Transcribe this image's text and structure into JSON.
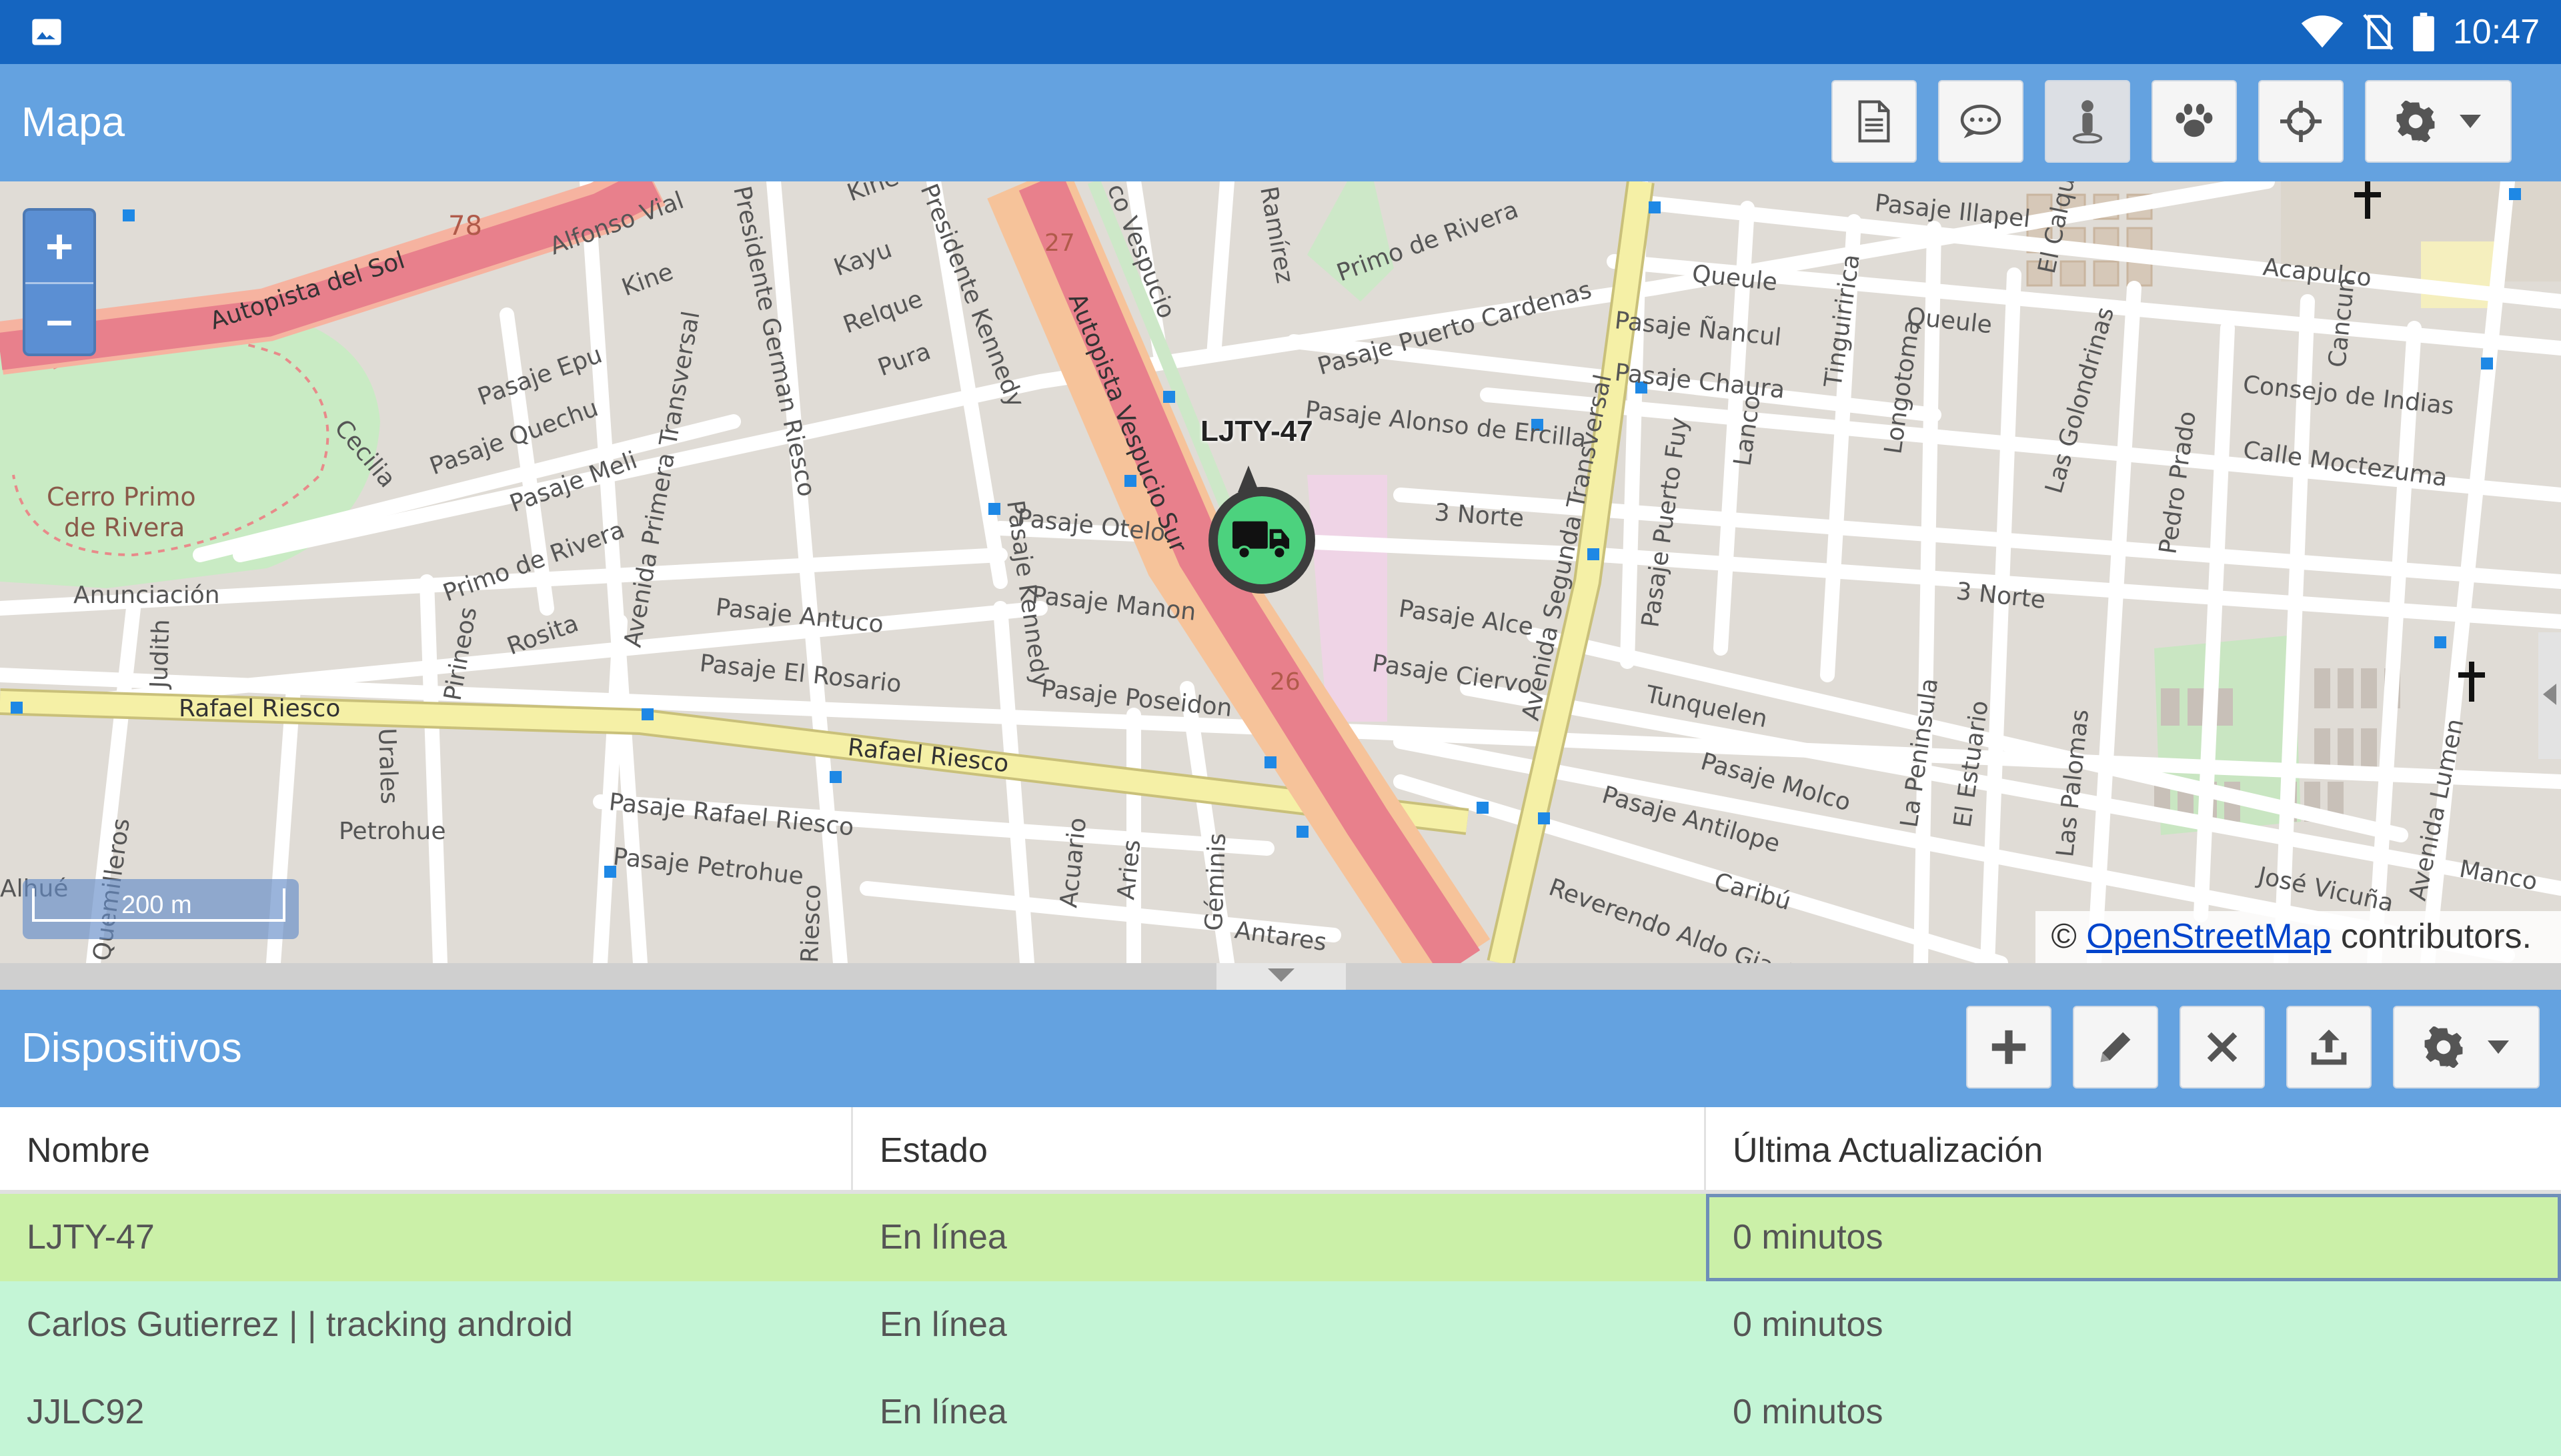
{
  "status_bar": {
    "time": "10:47",
    "icons": [
      "image-icon",
      "wifi-icon",
      "no-sim-icon",
      "battery-icon"
    ]
  },
  "map_panel": {
    "title": "Mapa",
    "toolbar": [
      "report-icon",
      "chat-icon",
      "person-pin-icon",
      "paw-icon",
      "crosshair-icon",
      "settings-dropdown-icon"
    ]
  },
  "map": {
    "zoom_in": "+",
    "zoom_out": "–",
    "scale": "200 m",
    "attribution_prefix": "©",
    "attribution_link": "OpenStreetMap",
    "attribution_suffix": "contributors.",
    "marker_label": "LJTY-47",
    "labels": {
      "autopista_sol": "Autopista del Sol",
      "route_78": "78",
      "alfonso_vial": "Alfonso Vial",
      "kine": "Kine",
      "kine2": "Kine",
      "kayu": "Kayu",
      "relque": "Relque",
      "pura": "Pura",
      "german_riesco": "Presidente German Riesco",
      "pres_kennedy": "Presidente Kennedy",
      "vespucio": "co Vespucio",
      "route_27": "27",
      "route_26": "26",
      "autopista_vespucio_sur": "Autopista Vespucio Sur",
      "pasaje_epu": "Pasaje Epu",
      "pasaje_quechu": "Pasaje Quechu",
      "pasaje_meli": "Pasaje Meli",
      "cecilia": "Cecilia",
      "cerro_primo": "Cerro Primo",
      "de_rivera": "de Rivera",
      "primo_rivera": "Primo de Rivera",
      "primo_rivera2": "Primo de Rivera",
      "anunciacion": "Anunciación",
      "rosita": "Rosita",
      "avda_primera": "Avenida Primera Transversal",
      "pirineos": "Pirineos",
      "judith": "Judith",
      "rafael_riesco": "Rafael Riesco",
      "rafael_riesco2": "Rafael Riesco",
      "pasaje_antuco": "Pasaje Antuco",
      "pasaje_el_rosario": "Pasaje El Rosario",
      "pasaje_otelo": "Pasaje Otelo",
      "pasaje_kennedy": "Pasaje Kennedy",
      "pasaje_manon": "Pasaje Manon",
      "pasaje_poseidon": "Pasaje Poseidon",
      "pasaje_rafael_riesco": "Pasaje Rafael Riesco",
      "pasaje_petrohue": "Pasaje Petrohue",
      "urales": "Urales",
      "petrohue": "Petrohue",
      "alhue": "Alhué",
      "acuario": "Acuario",
      "aries": "Aries",
      "geminis": "Géminis",
      "antares": "Antares",
      "pasaje_puerto_cardenas": "Pasaje Puerto Cardenas",
      "pasaje_alonso": "Pasaje Alonso de Ercilla",
      "tres_norte": "3 Norte",
      "tres_norte2": "3 Norte",
      "pasaje_alce": "Pasaje Alce",
      "pasaje_ciervo": "Pasaje Ciervo",
      "avda_segunda": "Avenida Segunda Transversal",
      "queule": "Queule",
      "queule2": "Queule",
      "pasaje_nancul": "Pasaje Ñancul",
      "pasaje_chaura": "Pasaje Chaura",
      "pasaje_illapel": "Pasaje Illapel",
      "tinguiririca": "Tinguiririca",
      "longotoma": "Longotoma",
      "lanco": "Lanco",
      "pasaje_puerto_fuy": "Pasaje Puerto Fuy",
      "tunquelen": "Tunquelen",
      "pasaje_molco": "Pasaje Molco",
      "pasaje_antilope": "Pasaje Antilope",
      "caribu": "Caribú",
      "reverendo": "Reverendo Aldo Giachi",
      "la_peninsula": "La Peninsula",
      "el_estuario": "El Estuario",
      "las_palomas": "Las Palomas",
      "las_golondrinas": "Las Golondrinas",
      "pedro_prado": "Pedro Prado",
      "acapulco": "Acapulco",
      "cancun": "Cancun",
      "consejo_indias": "Consejo de Indias",
      "calle_moctezuma": "Calle Moctezuma",
      "avda_lumen": "Avenida Lumen",
      "jose_vicuna": "José Vicuña",
      "manco": "Manco",
      "primo_rivera3": "Primo de Rivera",
      "el_calqui": "El Calqui",
      "quemilleros": "Quemilleros",
      "ramirez": "Ramírez",
      "riesco": "Riesco"
    }
  },
  "devices_panel": {
    "title": "Dispositivos",
    "toolbar": [
      "add-icon",
      "edit-icon",
      "remove-icon",
      "upload-icon",
      "settings-dropdown-icon"
    ],
    "columns": [
      "Nombre",
      "Estado",
      "Última Actualización"
    ],
    "rows": [
      {
        "name": "LJTY-47",
        "status": "En línea",
        "updated": "0 minutos"
      },
      {
        "name": "Carlos Gutierrez | | tracking android",
        "status": "En línea",
        "updated": "0 minutos"
      },
      {
        "name": "JJLC92",
        "status": "En línea",
        "updated": "0 minutos"
      }
    ]
  },
  "colors": {
    "status_bar": "#1565c0",
    "header": "#64a2e0",
    "selected_row": "#cbf0a8",
    "online_row": "#c4f5d6",
    "marker": "#4cd27e"
  }
}
